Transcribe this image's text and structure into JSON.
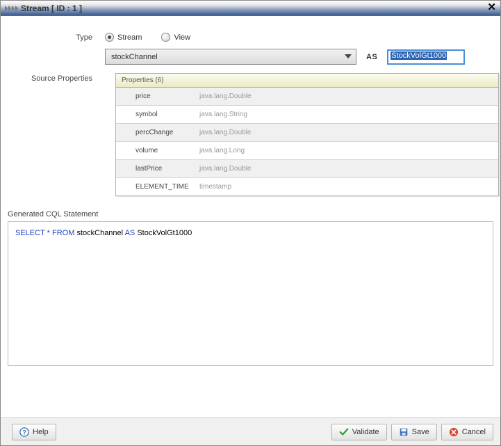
{
  "titlebar": {
    "title": "Stream [ ID : 1 ]"
  },
  "form": {
    "type_label": "Type",
    "radio_stream": "Stream",
    "radio_view": "View",
    "radio_selected": "stream",
    "source_value": "stockChannel",
    "as_label": "AS",
    "as_value": "StockVolGt1000",
    "source_props_label": "Source Properties"
  },
  "properties": {
    "header": "Properties (6)",
    "rows": [
      {
        "name": "price",
        "type": "java.lang.Double"
      },
      {
        "name": "symbol",
        "type": "java.lang.String"
      },
      {
        "name": "percChange",
        "type": "java.lang.Double"
      },
      {
        "name": "volume",
        "type": "java.lang.Long"
      },
      {
        "name": "lastPrice",
        "type": "java.lang.Double"
      },
      {
        "name": "ELEMENT_TIME",
        "type": "timestamp"
      }
    ]
  },
  "generated": {
    "label": "Generated CQL Statement",
    "cql": {
      "select": "SELECT",
      "star_from": "* FROM",
      "source": "stockChannel",
      "as": "AS",
      "alias": "StockVolGt1000"
    }
  },
  "footer": {
    "help": "Help",
    "validate": "Validate",
    "save": "Save",
    "cancel": "Cancel"
  }
}
